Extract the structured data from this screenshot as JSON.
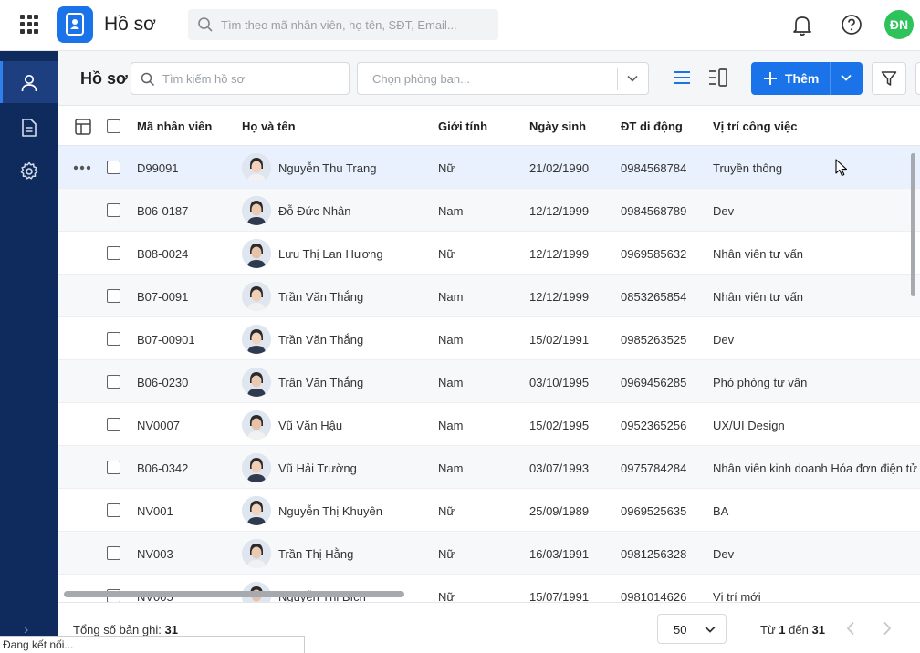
{
  "header": {
    "app_title": "Hồ sơ",
    "search_placeholder": "Tìm theo mã nhân viên, họ tên, SĐT, Email...",
    "user_initials": "ĐN",
    "avatar_color": "#2ec25b"
  },
  "sidebar": {
    "items": [
      {
        "icon": "person-icon",
        "active": true
      },
      {
        "icon": "document-icon",
        "active": false
      },
      {
        "icon": "gear-icon",
        "active": false
      }
    ],
    "expand_glyph": "›"
  },
  "toolbar": {
    "heading": "Hồ sơ",
    "search_placeholder": "Tìm kiếm hồ sơ",
    "department_placeholder": "Chọn phòng ban...",
    "add_label": "Thêm",
    "accent": "#1a73e8"
  },
  "table": {
    "columns": [
      "Mã nhân viên",
      "Họ và tên",
      "Giới tính",
      "Ngày sinh",
      "ĐT di động",
      "Vị trí công việc"
    ],
    "rows": [
      {
        "code": "D99091",
        "name": "Nguyễn Thu Trang",
        "gender": "Nữ",
        "dob": "21/02/1990",
        "phone": "0984568784",
        "position": "Truyền thông"
      },
      {
        "code": "B06-0187",
        "name": "Đỗ Đức Nhân",
        "gender": "Nam",
        "dob": "12/12/1999",
        "phone": "0984568789",
        "position": "Dev"
      },
      {
        "code": "B08-0024",
        "name": "Lưu Thị Lan Hương",
        "gender": "Nữ",
        "dob": "12/12/1999",
        "phone": "0969585632",
        "position": "Nhân viên tư vấn"
      },
      {
        "code": "B07-0091",
        "name": "Trần Văn Thắng",
        "gender": "Nam",
        "dob": "12/12/1999",
        "phone": "0853265854",
        "position": "Nhân viên tư vấn"
      },
      {
        "code": "B07-00901",
        "name": "Trần Văn Thắng",
        "gender": "Nam",
        "dob": "15/02/1991",
        "phone": "0985263525",
        "position": "Dev"
      },
      {
        "code": "B06-0230",
        "name": "Trần Văn Thắng",
        "gender": "Nam",
        "dob": "03/10/1995",
        "phone": "0969456285",
        "position": "Phó phòng tư vấn"
      },
      {
        "code": "NV0007",
        "name": "Vũ Văn Hậu",
        "gender": "Nam",
        "dob": "15/02/1995",
        "phone": "0952365256",
        "position": "UX/UI Design"
      },
      {
        "code": "B06-0342",
        "name": "Vũ Hải Trường",
        "gender": "Nam",
        "dob": "03/07/1993",
        "phone": "0975784284",
        "position": "Nhân viên kinh doanh Hóa đơn điện tử"
      },
      {
        "code": "NV001",
        "name": "Nguyễn Thị Khuyên",
        "gender": "Nữ",
        "dob": "25/09/1989",
        "phone": "0969525635",
        "position": "BA"
      },
      {
        "code": "NV003",
        "name": "Trần Thị Hằng",
        "gender": "Nữ",
        "dob": "16/03/1991",
        "phone": "0981256328",
        "position": "Dev"
      },
      {
        "code": "NV005",
        "name": "Nguyễn Thị Bích",
        "gender": "Nữ",
        "dob": "15/07/1991",
        "phone": "0981014626",
        "position": "Vị trí mới"
      }
    ]
  },
  "footer": {
    "total_label": "Tổng số bản ghi:",
    "total_value": "31",
    "page_size": "50",
    "range_from_label": "Từ",
    "range_from": "1",
    "range_to_label": "đến",
    "range_to": "31"
  },
  "status_text": "Đang kết nối..."
}
